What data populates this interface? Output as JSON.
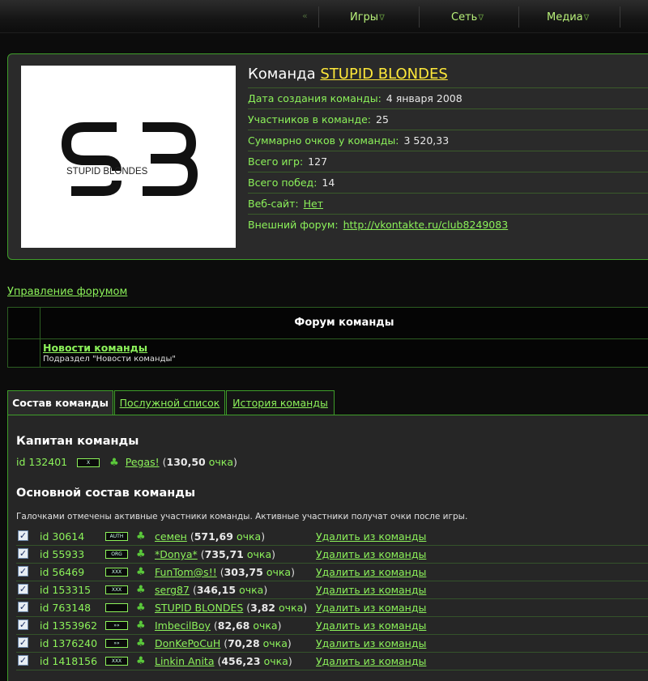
{
  "nav": {
    "back_glyph": "«",
    "items": [
      {
        "label": "Игры",
        "arrow": "∇"
      },
      {
        "label": "Сеть",
        "arrow": "∇"
      },
      {
        "label": "Медиа",
        "arrow": "∇"
      }
    ]
  },
  "team": {
    "title_prefix": "Команда",
    "name": "STUPID BLONDES",
    "logo_text": "STUPID BLONDES",
    "fields": [
      {
        "label": "Дата создания команды:",
        "value": "4 января 2008",
        "link": false
      },
      {
        "label": "Участников в команде:",
        "value": "25",
        "link": false
      },
      {
        "label": "Суммарно очков у команды:",
        "value": "3 520,33",
        "link": false
      },
      {
        "label": "Всего игр:",
        "value": "127",
        "link": false
      },
      {
        "label": "Всего побед:",
        "value": "14",
        "link": false
      },
      {
        "label": "Веб-сайт:",
        "value": "Нет",
        "link": true
      },
      {
        "label": "Внешний форум:",
        "value": "http://vkontakte.ru/club8249083",
        "link": true
      }
    ]
  },
  "forum": {
    "manage_link": "Управление форумом",
    "header": "Форум команды",
    "subforum_title": "Новости команды",
    "subforum_desc": "Подраздел \"Новости команды\""
  },
  "tabs": [
    "Состав команды",
    "Послужной список",
    "История команды"
  ],
  "captain": {
    "section_title": "Капитан команды",
    "id_label": "id",
    "id": "132401",
    "badge": "X",
    "name": "Pegas!",
    "points": "130,50",
    "points_word": "очка"
  },
  "roster": {
    "section_title": "Основной состав команды",
    "note": "Галочками отмечены активные участники команды. Активные участники получат очки после игры.",
    "delete_label": "Удалить из команды",
    "members": [
      {
        "id": "30614",
        "badge": "AUTH",
        "name": "семен",
        "points": "571,69",
        "checked": true
      },
      {
        "id": "55933",
        "badge": "ORG",
        "name": "*Donya*",
        "points": "735,71",
        "checked": true
      },
      {
        "id": "56469",
        "badge": "XXX",
        "name": "FunTom@s!!",
        "points": "303,75",
        "checked": true
      },
      {
        "id": "153315",
        "badge": "XXX",
        "name": "serg87",
        "points": "346,15",
        "checked": true
      },
      {
        "id": "763148",
        "badge": "",
        "name": "STUPID BLONDES",
        "points": "3,82",
        "checked": true
      },
      {
        "id": "1353962",
        "badge": "»»",
        "name": "ImbecilBoy",
        "points": "82,68",
        "checked": true
      },
      {
        "id": "1376240",
        "badge": "»»",
        "name": "DonKePoCuH",
        "points": "70,28",
        "checked": true
      },
      {
        "id": "1418156",
        "badge": "XXX",
        "name": "Linkin Anita",
        "points": "456,23",
        "checked": true
      }
    ]
  },
  "colors": {
    "accent": "#8cf25a",
    "highlight": "#ffe93a",
    "border": "#3f9e2a"
  }
}
